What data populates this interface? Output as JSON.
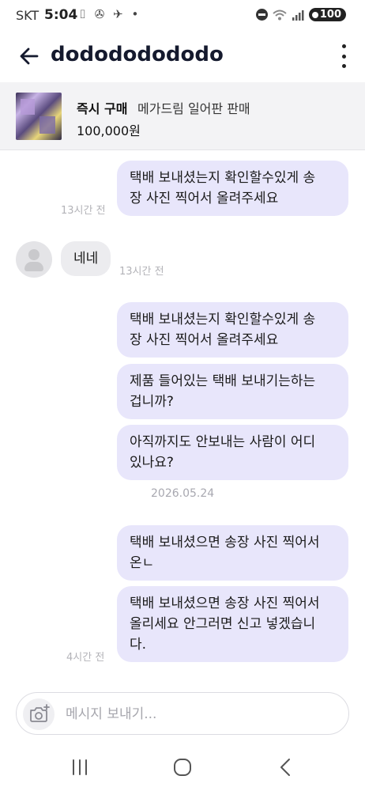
{
  "status_bar": {
    "carrier": "SKT",
    "time": "5:04",
    "notif_icons": "⌷ ✇ ✈ •",
    "battery": "100"
  },
  "header": {
    "title": "dodododododo"
  },
  "product": {
    "status": "즉시 구매",
    "name": "메가드림 일어판 판매",
    "price": "100,000원"
  },
  "messages": [
    {
      "id": "m1",
      "direction": "out",
      "lines": [
        "택배 보내셨는지 확인할수있게 송",
        "장 사진 찍어서 올려주세요"
      ],
      "time": "13시간 전"
    },
    {
      "id": "m2",
      "direction": "in",
      "lines": [
        "네네"
      ],
      "time": "13시간 전"
    },
    {
      "id": "m3",
      "direction": "out",
      "lines": [
        "택배 보내셨는지 확인할수있게 송",
        "장 사진 찍어서 올려주세요"
      ]
    },
    {
      "id": "m4",
      "direction": "out",
      "lines": [
        "제품 들어있는 택배 보내기는하는",
        "겁니까?"
      ]
    },
    {
      "id": "m5",
      "direction": "out",
      "lines": [
        "아직까지도 안보내는 사람이 어디",
        "있나요?"
      ]
    },
    {
      "id": "m6",
      "direction": "out",
      "lines": [
        "택배 보내셨으면 송장 사진 찍어서",
        "온ㄴ"
      ]
    },
    {
      "id": "m7",
      "direction": "out",
      "lines": [
        "택배 보내셨으면 송장 사진 찍어서",
        "올리세요 안그러면 신고 넣겠습니",
        "다."
      ],
      "time": "4시간 전"
    }
  ],
  "date_separator": "2026.05.24",
  "composer": {
    "placeholder": "메시지 보내기..."
  },
  "colors": {
    "outgoing_bubble": "#e8e6fb",
    "incoming_bubble": "#ececef",
    "title": "#151a2e"
  },
  "icons": [
    "back-arrow-icon",
    "more-vertical-icon",
    "camera-plus-icon",
    "recent-apps-icon",
    "home-icon",
    "nav-back-icon"
  ]
}
